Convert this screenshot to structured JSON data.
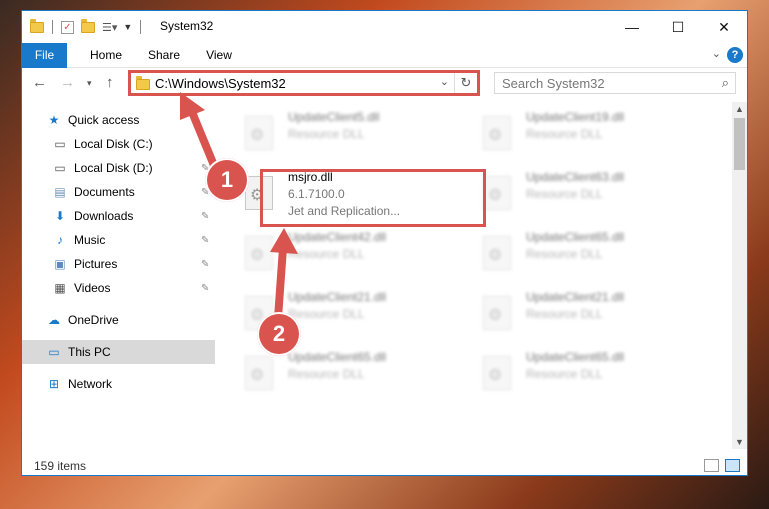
{
  "window": {
    "title": "System32",
    "controls": {
      "minimize": "—",
      "maximize": "☐",
      "close": "✕"
    }
  },
  "ribbon": {
    "tabs": [
      {
        "label": "File"
      },
      {
        "label": "Home"
      },
      {
        "label": "Share"
      },
      {
        "label": "View"
      }
    ],
    "help": "?"
  },
  "address": {
    "path": "C:\\Windows\\System32",
    "search_placeholder": "Search System32"
  },
  "sidebar": {
    "items": [
      {
        "label": "Quick access",
        "icon": "star-icon",
        "pinned": false
      },
      {
        "label": "Local Disk (C:)",
        "icon": "drive-icon",
        "pinned": true
      },
      {
        "label": "Local Disk (D:)",
        "icon": "drive-icon",
        "pinned": true
      },
      {
        "label": "Documents",
        "icon": "documents-icon",
        "pinned": true
      },
      {
        "label": "Downloads",
        "icon": "download-icon",
        "pinned": true
      },
      {
        "label": "Music",
        "icon": "music-icon",
        "pinned": true
      },
      {
        "label": "Pictures",
        "icon": "pictures-icon",
        "pinned": true
      },
      {
        "label": "Videos",
        "icon": "videos-icon",
        "pinned": true
      },
      {
        "label": "OneDrive",
        "icon": "cloud-icon",
        "pinned": false
      },
      {
        "label": "This PC",
        "icon": "computer-icon",
        "pinned": false,
        "selected": true
      },
      {
        "label": "Network",
        "icon": "network-icon",
        "pinned": false
      }
    ]
  },
  "files": {
    "left": [
      {
        "name": "UpdateClient5.dll",
        "line2": "Resource DLL",
        "line3": ""
      },
      {
        "name": "msjro.dll",
        "line2": "6.1.7100.0",
        "line3": "Jet and Replication...",
        "highlighted": true
      },
      {
        "name": "UpdateClient42.dll",
        "line2": "Resource DLL",
        "line3": ""
      },
      {
        "name": "UpdateClient21.dll",
        "line2": "Resource DLL",
        "line3": ""
      },
      {
        "name": "UpdateClient65.dll",
        "line2": "Resource DLL",
        "line3": ""
      }
    ],
    "right": [
      {
        "name": "UpdateClient19.dll",
        "line2": "Resource DLL",
        "line3": ""
      },
      {
        "name": "UpdateClient63.dll",
        "line2": "Resource DLL",
        "line3": ""
      },
      {
        "name": "UpdateClient65.dll",
        "line2": "Resource DLL",
        "line3": ""
      },
      {
        "name": "UpdateClient21.dll",
        "line2": "Resource DLL",
        "line3": ""
      },
      {
        "name": "UpdateClient65.dll",
        "line2": "Resource DLL",
        "line3": ""
      }
    ]
  },
  "status": {
    "item_count": "159 items"
  },
  "annotations": {
    "badge1": "1",
    "badge2": "2"
  },
  "colors": {
    "accent": "#1979ca",
    "annotation": "#d9534f",
    "selected": "#d9d9d9"
  }
}
